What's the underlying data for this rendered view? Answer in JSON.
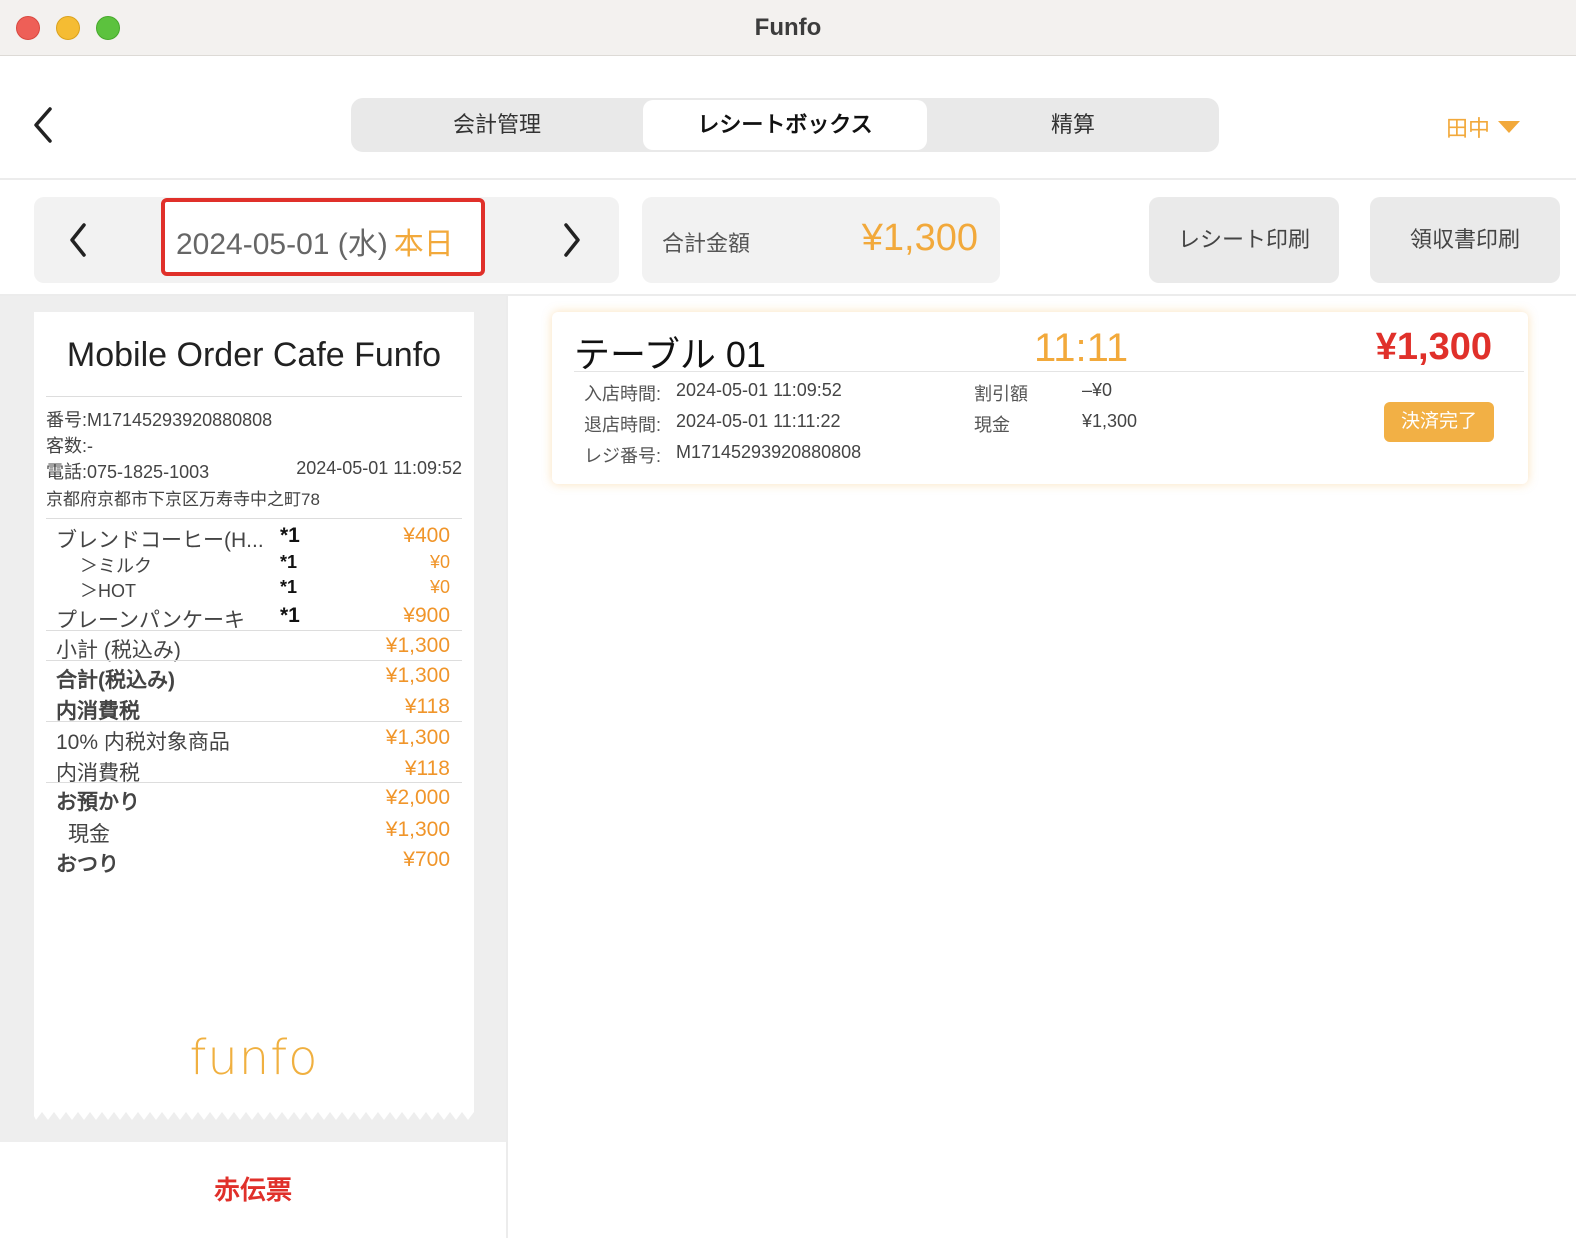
{
  "window": {
    "title": "Funfo"
  },
  "header": {
    "tabs": [
      "会計管理",
      "レシートボックス",
      "精算"
    ],
    "active_tab": "レシートボックス",
    "user": "田中"
  },
  "date_nav": {
    "date": "2024-05-01 (水)",
    "today": "本日"
  },
  "total": {
    "label": "合計金額",
    "value": "¥1,300"
  },
  "actions": {
    "receipt_print": "レシート印刷",
    "invoice_print": "領収書印刷"
  },
  "receipt": {
    "store_name": "Mobile Order Cafe Funfo",
    "number": "番号:M17145293920880808",
    "guests": "客数:-",
    "phone": "電話:075-1825-1003",
    "datetime": "2024-05-01 11:09:52",
    "address": "京都府京都市下京区万寿寺中之町78",
    "items": [
      {
        "name": "ブレンドコーヒー(H...",
        "qty": "*1",
        "price": "¥400"
      },
      {
        "name": "＞ミルク",
        "qty": "*1",
        "price": "¥0"
      },
      {
        "name": "＞HOT",
        "qty": "*1",
        "price": "¥0"
      },
      {
        "name": "プレーンパンケーキ",
        "qty": "*1",
        "price": "¥900"
      }
    ],
    "subtotal": {
      "label": "小計 (税込み)",
      "value": "¥1,300"
    },
    "total": {
      "label": "合計(税込み)",
      "value": "¥1,300"
    },
    "tax": {
      "label": "内消費税",
      "value": "¥118"
    },
    "tax10_items": {
      "label": "10% 内税対象商品",
      "value": "¥1,300"
    },
    "tax10": {
      "label": "内消費税",
      "value": "¥118"
    },
    "deposit": {
      "label": "お預かり",
      "value": "¥2,000"
    },
    "cash": {
      "label": "現金",
      "value": "¥1,300"
    },
    "change": {
      "label": "おつり",
      "value": "¥700"
    },
    "logo_text": "funfo"
  },
  "red_slip": "赤伝票",
  "order_card": {
    "table": "テーブル 01",
    "time": "11:11",
    "amount": "¥1,300",
    "entry_label": "入店時間:",
    "entry_value": "2024-05-01 11:09:52",
    "exit_label": "退店時間:",
    "exit_value": "2024-05-01 11:11:22",
    "register_label": "レジ番号:",
    "register_value": "M17145293920880808",
    "discount_label": "割引額",
    "discount_value": "–¥0",
    "cash_label": "現金",
    "cash_value": "¥1,300",
    "status": "決済完了"
  },
  "colors": {
    "accent": "#f2a93b",
    "price": "#f0952a",
    "alert": "#e0302a"
  }
}
